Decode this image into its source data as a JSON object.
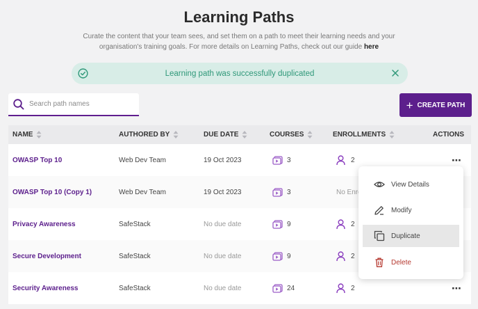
{
  "header": {
    "title": "Learning Paths",
    "subtitle_text": "Curate the content that your team sees, and set them on a path to meet their learning needs and your organisation's training goals. For more details on Learning Paths, check out our guide",
    "subtitle_link": "here"
  },
  "toast": {
    "message": "Learning path was successfully duplicated",
    "icon": "check-circle-icon",
    "close_icon": "close-icon",
    "color": "#2f9879"
  },
  "search": {
    "placeholder": "Search path names",
    "value": ""
  },
  "create_button": {
    "label": "CREATE PATH",
    "color": "#5c1f8c"
  },
  "table": {
    "columns": [
      "NAME",
      "AUTHORED BY",
      "DUE DATE",
      "COURSES",
      "ENROLLMENTS",
      "ACTIONS"
    ],
    "rows": [
      {
        "name": "OWASP Top 10",
        "author": "Web Dev Team",
        "due": "19 Oct 2023",
        "courses": "3",
        "enrollments": "2"
      },
      {
        "name": "OWASP Top 10 (Copy 1)",
        "author": "Web Dev Team",
        "due": "19 Oct 2023",
        "courses": "3",
        "enrollments": "No Enrol"
      },
      {
        "name": "Privacy Awareness",
        "author": "SafeStack",
        "due": "No due date",
        "courses": "9",
        "enrollments": "2"
      },
      {
        "name": "Secure Development",
        "author": "SafeStack",
        "due": "No due date",
        "courses": "9",
        "enrollments": "2"
      },
      {
        "name": "Security Awareness",
        "author": "SafeStack",
        "due": "No due date",
        "courses": "24",
        "enrollments": "2"
      }
    ],
    "actions_glyph": "⋯"
  },
  "actions_menu": {
    "items": [
      {
        "label": "View Details",
        "icon": "eye-icon"
      },
      {
        "label": "Modify",
        "icon": "pencil-icon"
      },
      {
        "label": "Duplicate",
        "icon": "duplicate-icon",
        "highlighted": true
      },
      {
        "label": "Delete",
        "icon": "trash-icon",
        "danger": true
      }
    ]
  }
}
